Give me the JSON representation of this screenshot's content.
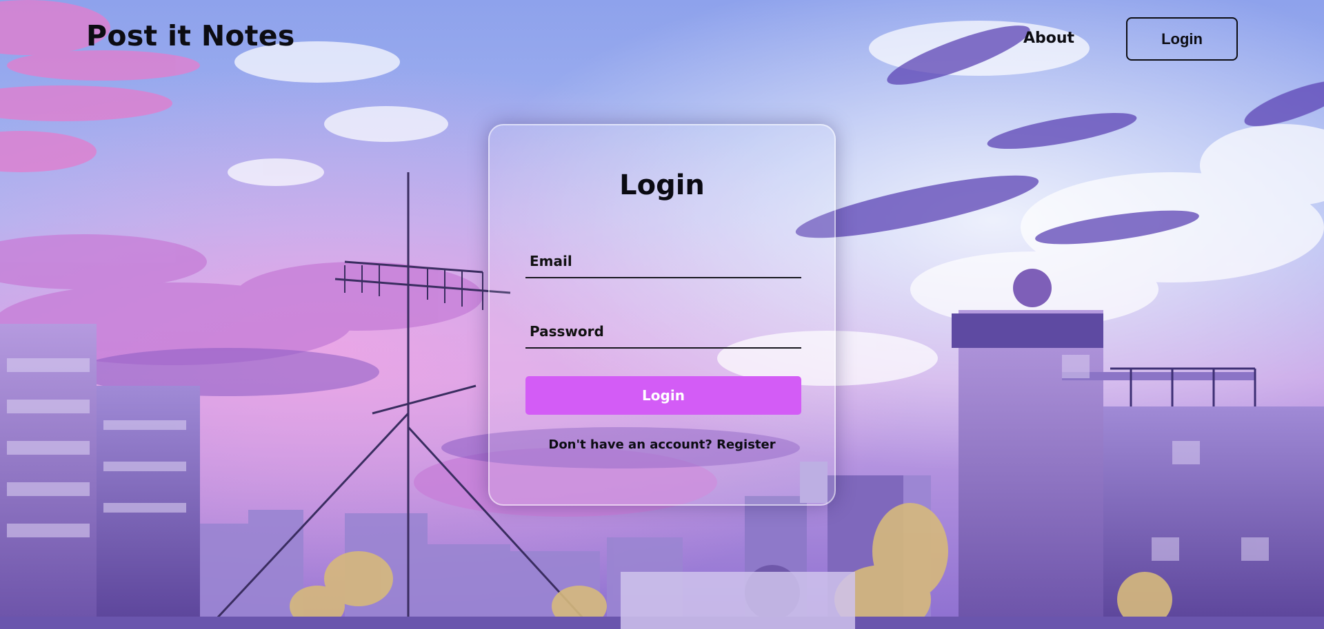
{
  "header": {
    "logo": "Post it Notes",
    "nav": {
      "about": "About",
      "login": "Login"
    }
  },
  "login_card": {
    "title": "Login",
    "email_placeholder": "Email",
    "password_placeholder": "Password",
    "submit_label": "Login",
    "register_prompt": "Don't have an account?",
    "register_link": "Register"
  },
  "colors": {
    "accent": "#d35cf6",
    "text": "#0c0c12"
  }
}
